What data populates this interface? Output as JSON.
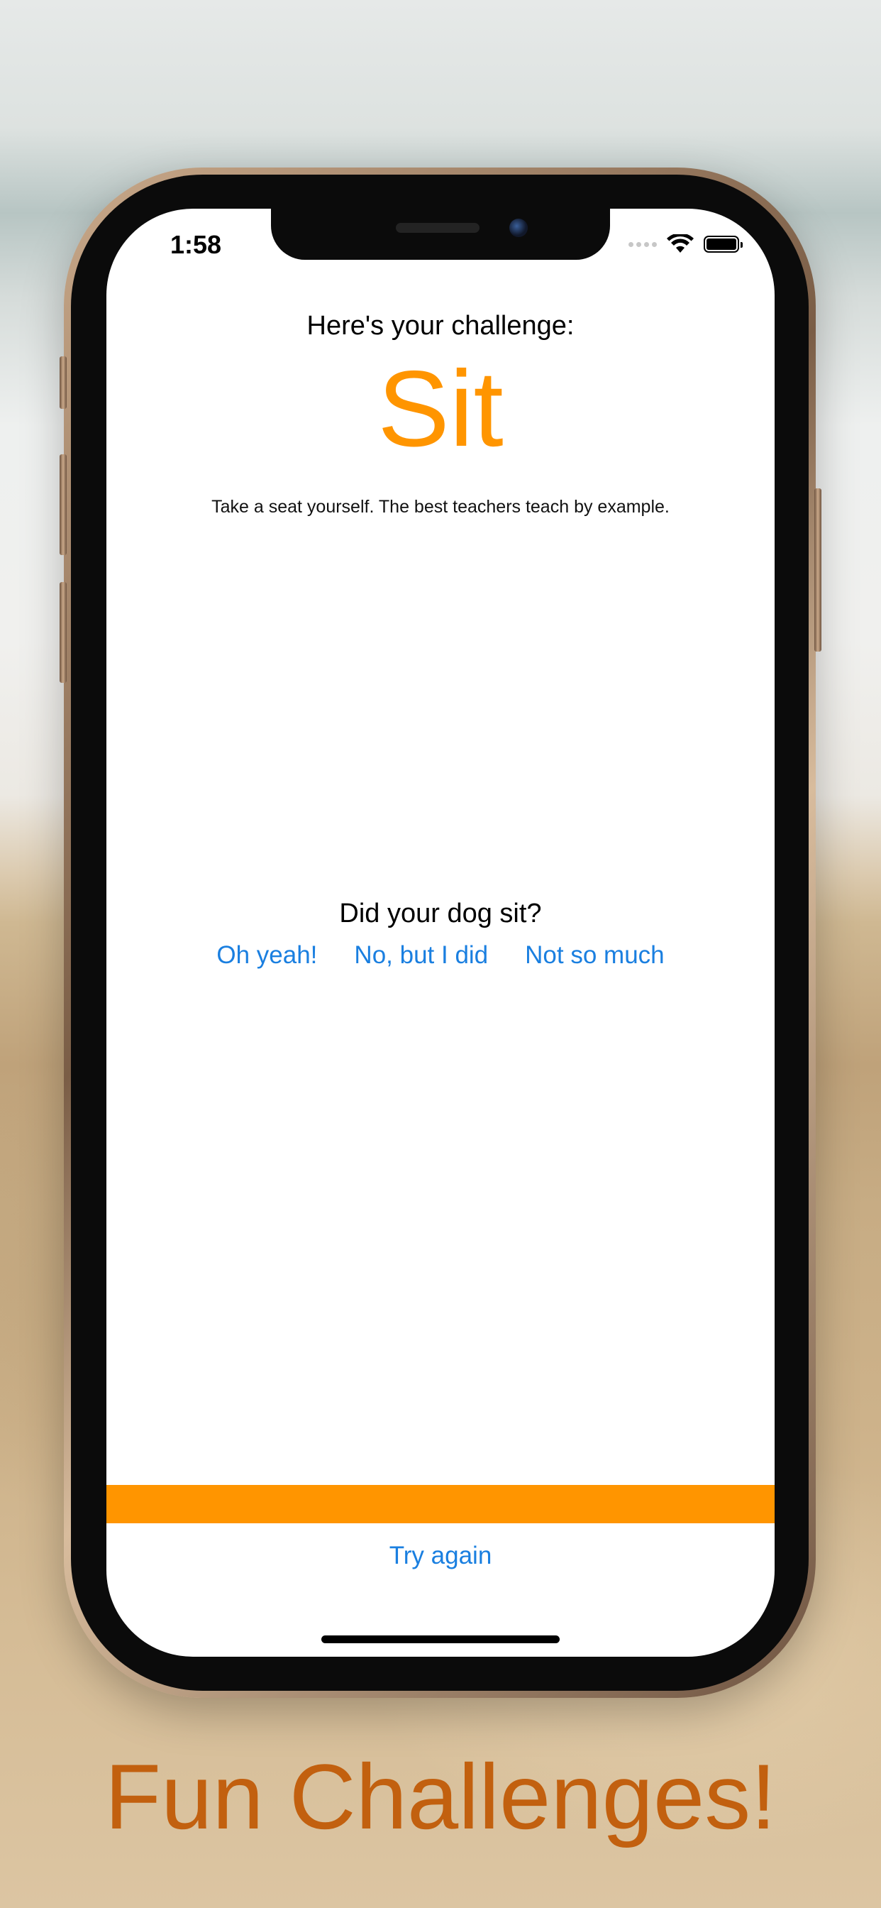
{
  "status_bar": {
    "time": "1:58",
    "icons": [
      "signal-dots-icon",
      "wifi-icon",
      "battery-icon"
    ]
  },
  "challenge": {
    "heading": "Here's your challenge:",
    "name": "Sit",
    "description": "Take a seat yourself. The best teachers teach by example."
  },
  "feedback": {
    "question": "Did your dog sit?",
    "options": [
      "Oh yeah!",
      "No, but I did",
      "Not so much"
    ]
  },
  "progress": {
    "fraction": 1.0,
    "color": "#ff9500"
  },
  "actions": {
    "try_again": "Try again"
  },
  "caption": "Fun Challenges!",
  "colors": {
    "accent": "#ff9500",
    "link": "#1a7fe0",
    "caption": "#c2600f"
  }
}
